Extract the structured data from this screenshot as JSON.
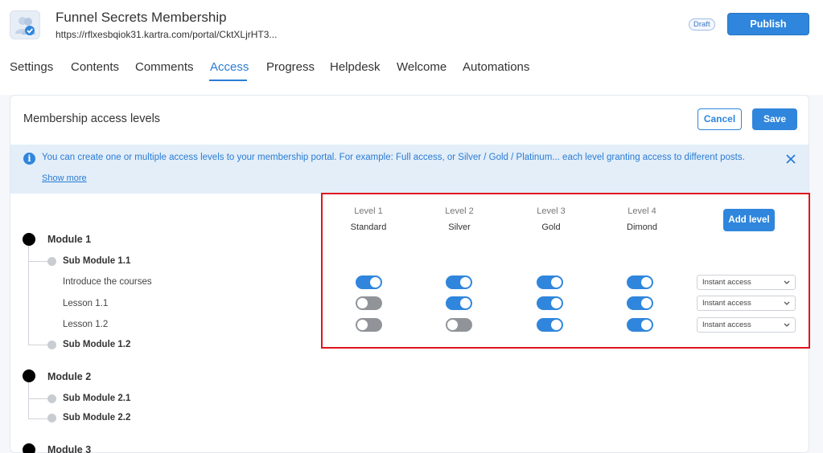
{
  "header": {
    "title": "Funnel Secrets Membership",
    "url": "https://rflxesbqiok31.kartra.com/portal/CktXLjrHT3...",
    "badge": "Draft",
    "publish_label": "Publish"
  },
  "tabs": [
    {
      "label": "Settings"
    },
    {
      "label": "Contents"
    },
    {
      "label": "Comments"
    },
    {
      "label": "Access",
      "active": true
    },
    {
      "label": "Progress"
    },
    {
      "label": "Helpdesk"
    },
    {
      "label": "Welcome"
    },
    {
      "label": "Automations"
    }
  ],
  "card": {
    "title": "Membership access levels",
    "cancel_label": "Cancel",
    "save_label": "Save"
  },
  "info": {
    "text": "You can create one or multiple access levels to your membership portal. For example: Full access, or Silver / Gold / Platinum... each level granting access to different posts.",
    "show_more": "Show more"
  },
  "levels": [
    {
      "name": "Level 1",
      "tier": "Standard"
    },
    {
      "name": "Level 2",
      "tier": "Silver"
    },
    {
      "name": "Level 3",
      "tier": "Gold"
    },
    {
      "name": "Level 4",
      "tier": "Dimond"
    }
  ],
  "add_level_label": "Add level",
  "tree": {
    "modules": [
      {
        "label": "Module 1"
      },
      {
        "label": "Module 2"
      },
      {
        "label": "Module 3"
      }
    ],
    "submodules": [
      {
        "label": "Sub Module 1.1"
      },
      {
        "label": "Sub Module 1.2"
      },
      {
        "label": "Sub Module 2.1"
      },
      {
        "label": "Sub Module 2.2"
      }
    ],
    "lessons": [
      {
        "label": "Introduce the courses",
        "access": [
          true,
          true,
          true,
          true
        ],
        "select": "Instant access"
      },
      {
        "label": "Lesson 1.1",
        "access": [
          false,
          true,
          true,
          true
        ],
        "select": "Instant access"
      },
      {
        "label": "Lesson 1.2",
        "access": [
          false,
          false,
          true,
          true
        ],
        "select": "Instant access"
      }
    ]
  },
  "colors": {
    "accent": "#2f86dc",
    "toggle_off": "#909499",
    "highlight": "#e0141e",
    "info_bg": "#e3eef9"
  }
}
